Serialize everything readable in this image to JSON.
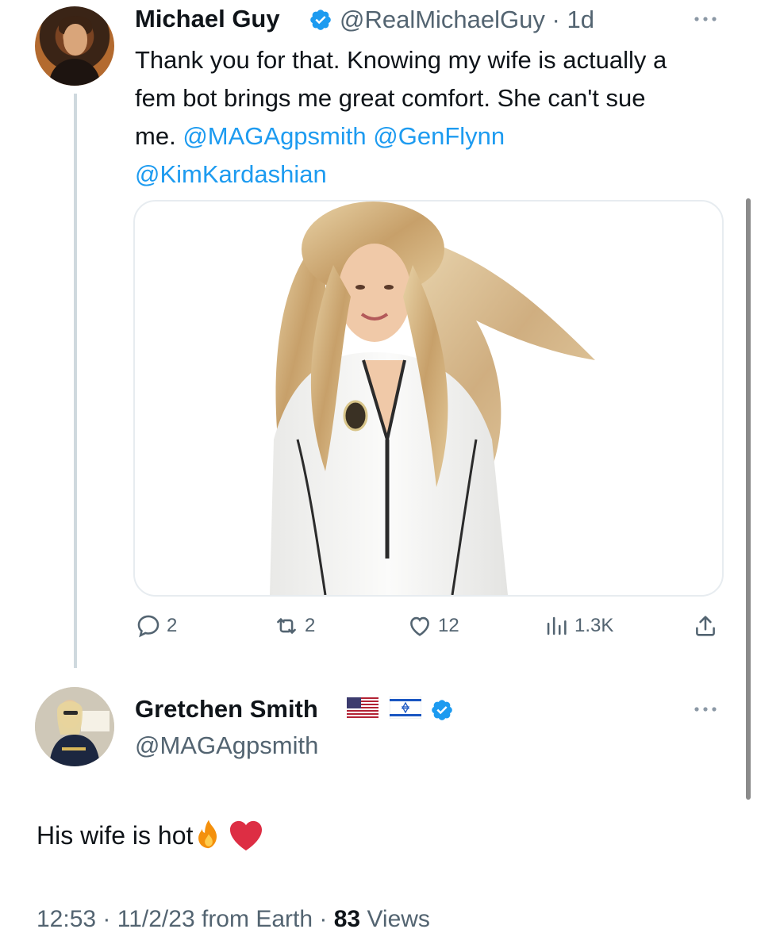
{
  "tweet": {
    "author_name": "Michael Guy",
    "author_handle": "@RealMichaelGuy",
    "time_sep": "·",
    "time": "1d",
    "text": "Thank you for that. Knowing my wife is actually a fem bot brings me great comfort. She can't sue me.",
    "mentions": [
      "@MAGAgpsmith",
      "@GenFlynn",
      "@KimKardashian"
    ],
    "stats": {
      "replies": "2",
      "retweets": "2",
      "likes": "12",
      "views": "1.3K"
    }
  },
  "reply": {
    "author_name": "Gretchen Smith",
    "author_handle": "@MAGAgpsmith",
    "name_flags": [
      "us-flag-icon",
      "israel-flag-icon"
    ],
    "text": "His wife is hot",
    "text_emojis": [
      "fire-icon",
      "red-heart-icon"
    ],
    "time": "12:53",
    "date": "11/2/23",
    "source": "from Earth",
    "views_count": "83",
    "views_label": "Views",
    "sep": "·"
  },
  "colors": {
    "link": "#1d9bf0",
    "secondary_text": "#536471",
    "primary_text": "#0f1419",
    "verified": "#1d9bf0"
  }
}
